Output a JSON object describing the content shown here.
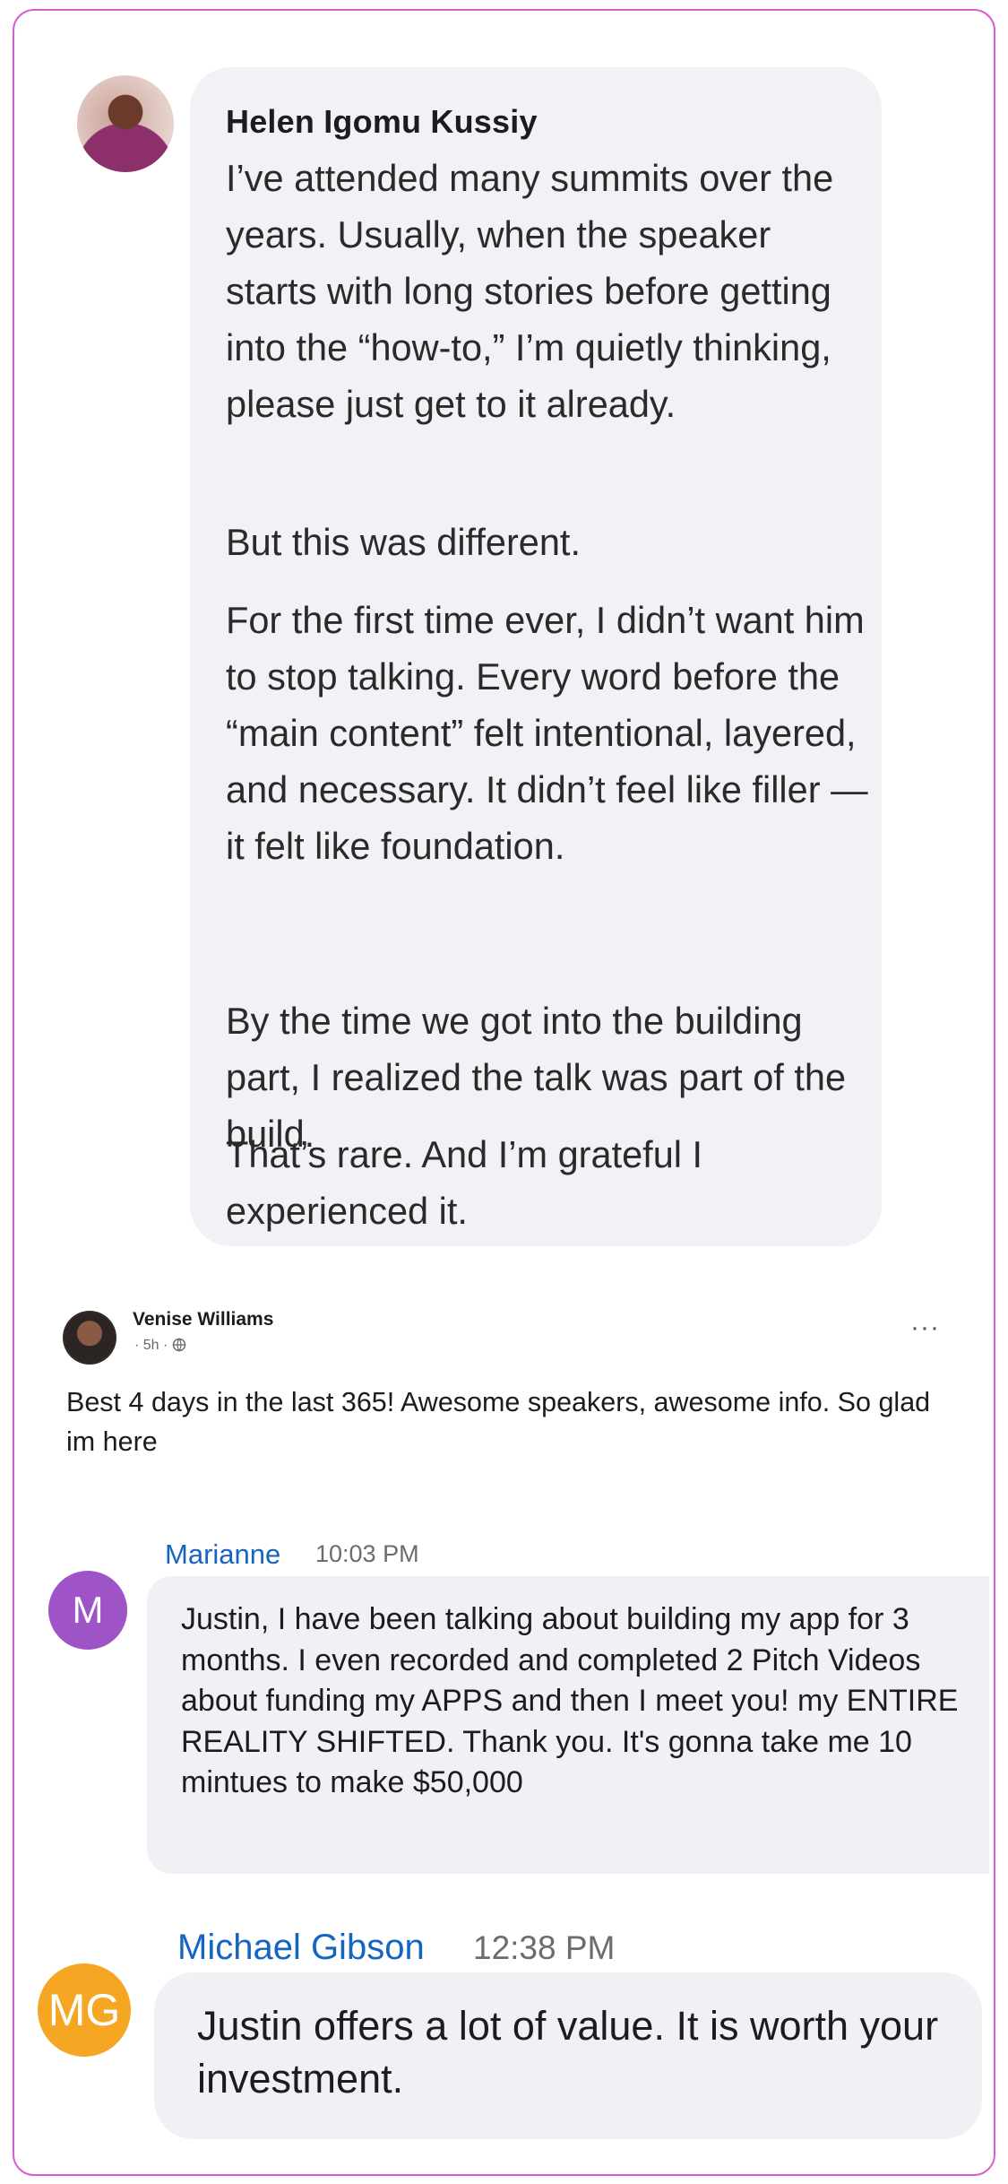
{
  "helen": {
    "name": "Helen Igomu Kussiy",
    "paragraphs": [
      "I’ve attended many summits over the years. Usually, when the speaker starts with long stories before getting into the “how-to,” I’m quietly thinking, please just get to it already.",
      "But this was different.",
      "For the first time ever, I didn’t want him to stop talking. Every word before the “main content” felt intentional, layered, and necessary. It didn’t feel like filler — it felt like foundation.",
      "By the time we got into the building part, I realized the talk was part of the build.",
      "That’s rare. And I’m grateful I experienced it."
    ]
  },
  "venise": {
    "name": "Venise Williams",
    "meta": "· 5h ·",
    "text": "Best 4 days in the last 365! Awesome speakers, awesome info. So glad im here",
    "more": "···"
  },
  "marianne": {
    "name": "Marianne",
    "time": "10:03 PM",
    "avatar_initial": "M",
    "avatar_color": "#9e54c6",
    "text": "Justin, I have been talking about building my app for 3 months. I even recorded and completed 2 Pitch Videos about funding my APPS and then I meet you! my ENTIRE REALITY SHIFTED. Thank you. It's gonna take me 10 mintues to make $50,000"
  },
  "michael": {
    "name": "Michael Gibson",
    "time": "12:38 PM",
    "avatar_initial": "MG",
    "avatar_color": "#f5a623",
    "text": "Justin offers a lot of value. It is worth your investment."
  },
  "colors": {
    "frame_border": "#d65fd0",
    "name_blue": "#1565c0",
    "bubble_grey": "#f0f2f5"
  }
}
